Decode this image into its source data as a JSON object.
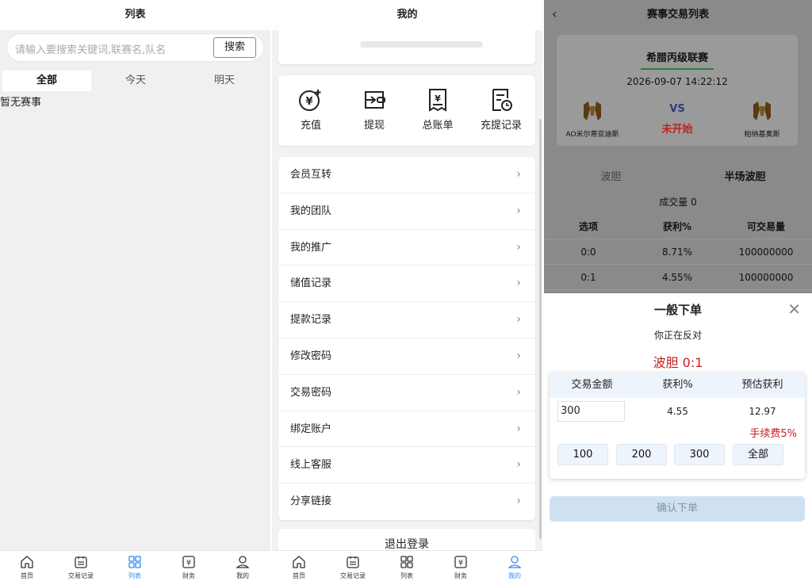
{
  "list_screen": {
    "title": "列表",
    "search": {
      "placeholder": "请输入要搜索关键词,联赛名,队名",
      "button": "搜索"
    },
    "tabs": [
      {
        "label": "全部",
        "active": true
      },
      {
        "label": "今天"
      },
      {
        "label": "明天"
      }
    ],
    "empty_text": "暂无赛事",
    "nav": [
      {
        "label": "首页",
        "icon": "home-icon"
      },
      {
        "label": "交易记录",
        "icon": "records-icon"
      },
      {
        "label": "列表",
        "icon": "grid-icon",
        "active": true
      },
      {
        "label": "财务",
        "icon": "finance-icon"
      },
      {
        "label": "我的",
        "icon": "user-icon"
      }
    ]
  },
  "mine_screen": {
    "title": "我的",
    "actions": [
      {
        "label": "充值",
        "icon": "recharge-icon"
      },
      {
        "label": "提现",
        "icon": "withdraw-icon"
      },
      {
        "label": "总账单",
        "icon": "bill-icon"
      },
      {
        "label": "充提记录",
        "icon": "history-icon"
      }
    ],
    "menu": [
      "会员互转",
      "我的团队",
      "我的推广",
      "储值记录",
      "提款记录",
      "修改密码",
      "交易密码",
      "绑定账户",
      "线上客服",
      "分享链接"
    ],
    "logout": "退出登录",
    "nav": [
      {
        "label": "首页",
        "icon": "home-icon"
      },
      {
        "label": "交易记录",
        "icon": "records-icon"
      },
      {
        "label": "列表",
        "icon": "grid-icon"
      },
      {
        "label": "财务",
        "icon": "finance-icon"
      },
      {
        "label": "我的",
        "icon": "user-icon",
        "active": true
      }
    ]
  },
  "trade_screen": {
    "title": "赛事交易列表",
    "league": "希腊丙级联赛",
    "time": "2026-09-07 14:22:12",
    "home_team": "AO米尔蒂亚迪斯",
    "away_team": "帕纳基奥斯",
    "vs": "VS",
    "status": "未开始",
    "tabs": [
      "波胆",
      "半场波胆"
    ],
    "volume": "成交量 0",
    "table_headers": [
      "选项",
      "获利%",
      "可交易量"
    ],
    "rows": [
      [
        "0:0",
        "8.71%",
        "100000000"
      ],
      [
        "0:1",
        "4.55%",
        "100000000"
      ]
    ],
    "order": {
      "title": "一般下单",
      "subtitle": "你正在反对",
      "pick": "波胆 0:1",
      "headers": [
        "交易金额",
        "获利%",
        "预估获利"
      ],
      "amount": "300",
      "profit": "4.55",
      "estimate": "12.97",
      "fee": "手续费5%",
      "quick": [
        "100",
        "200",
        "300",
        "全部"
      ],
      "confirm": "确认下单"
    }
  },
  "colors": {
    "accent": "#2a8cf4",
    "red": "#c62020",
    "confirm_bg": "#cfe1f1"
  }
}
